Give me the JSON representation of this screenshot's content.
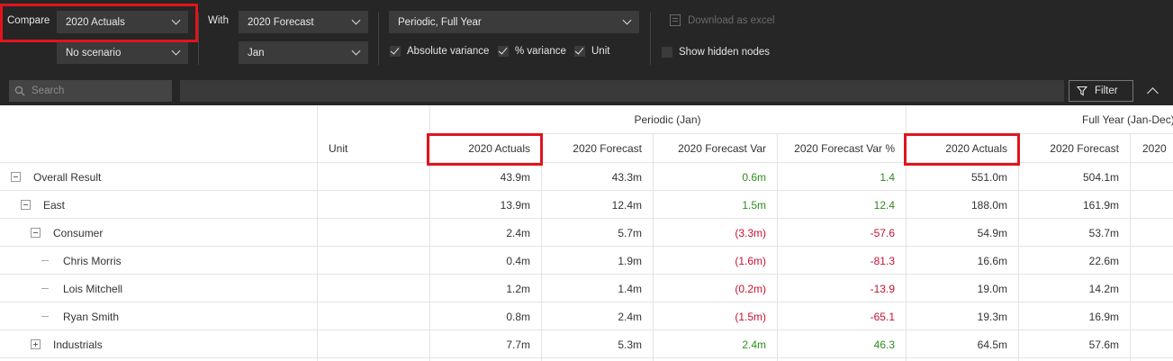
{
  "toolbar": {
    "compare_label": "Compare",
    "compare_value": "2020 Actuals",
    "scenario_value": "No scenario",
    "with_label": "With",
    "with_value": "2020 Forecast",
    "period_value": "Jan",
    "view_value": "Periodic, Full Year",
    "checks": [
      {
        "label": "Absolute variance",
        "checked": true
      },
      {
        "label": "% variance",
        "checked": true
      },
      {
        "label": "Unit",
        "checked": true
      }
    ],
    "download_label": "Download as excel",
    "show_hidden_label": "Show hidden nodes",
    "show_hidden_checked": false
  },
  "searchbar": {
    "search_placeholder": "Search",
    "filter_label": "Filter"
  },
  "table": {
    "unit_header": "Unit",
    "group_headers": [
      "Periodic (Jan)",
      "Full Year (Jan-Dec)"
    ],
    "columns": [
      "2020 Actuals",
      "2020 Forecast",
      "2020 Forecast Var",
      "2020 Forecast Var %",
      "2020 Actuals",
      "2020 Forecast",
      "2020"
    ],
    "rows": [
      {
        "name": "Overall Result",
        "toggle": "minus",
        "values": [
          "43.9m",
          "43.3m",
          "0.6m",
          "1.4",
          "551.0m",
          "504.1m"
        ],
        "var_sign": "pos"
      },
      {
        "name": "East",
        "toggle": "minus",
        "values": [
          "13.9m",
          "12.4m",
          "1.5m",
          "12.4",
          "188.0m",
          "161.9m"
        ],
        "var_sign": "pos"
      },
      {
        "name": "Consumer",
        "toggle": "minus",
        "values": [
          "2.4m",
          "5.7m",
          "(3.3m)",
          "-57.6",
          "54.9m",
          "53.7m"
        ],
        "var_sign": "neg"
      },
      {
        "name": "Chris Morris",
        "toggle": "leaf",
        "values": [
          "0.4m",
          "1.9m",
          "(1.6m)",
          "-81.3",
          "16.6m",
          "22.6m"
        ],
        "var_sign": "neg"
      },
      {
        "name": "Lois Mitchell",
        "toggle": "leaf",
        "values": [
          "1.2m",
          "1.4m",
          "(0.2m)",
          "-13.9",
          "19.0m",
          "14.2m"
        ],
        "var_sign": "neg"
      },
      {
        "name": "Ryan Smith",
        "toggle": "leaf",
        "values": [
          "0.8m",
          "2.4m",
          "(1.5m)",
          "-65.1",
          "19.3m",
          "16.9m"
        ],
        "var_sign": "neg"
      },
      {
        "name": "Industrials",
        "toggle": "plus",
        "values": [
          "7.7m",
          "5.3m",
          "2.4m",
          "46.3",
          "64.5m",
          "57.6m"
        ],
        "var_sign": "pos"
      }
    ]
  },
  "colors": {
    "positive": "#2e8b1e",
    "negative": "#c41230",
    "highlight": "#e0141e"
  }
}
